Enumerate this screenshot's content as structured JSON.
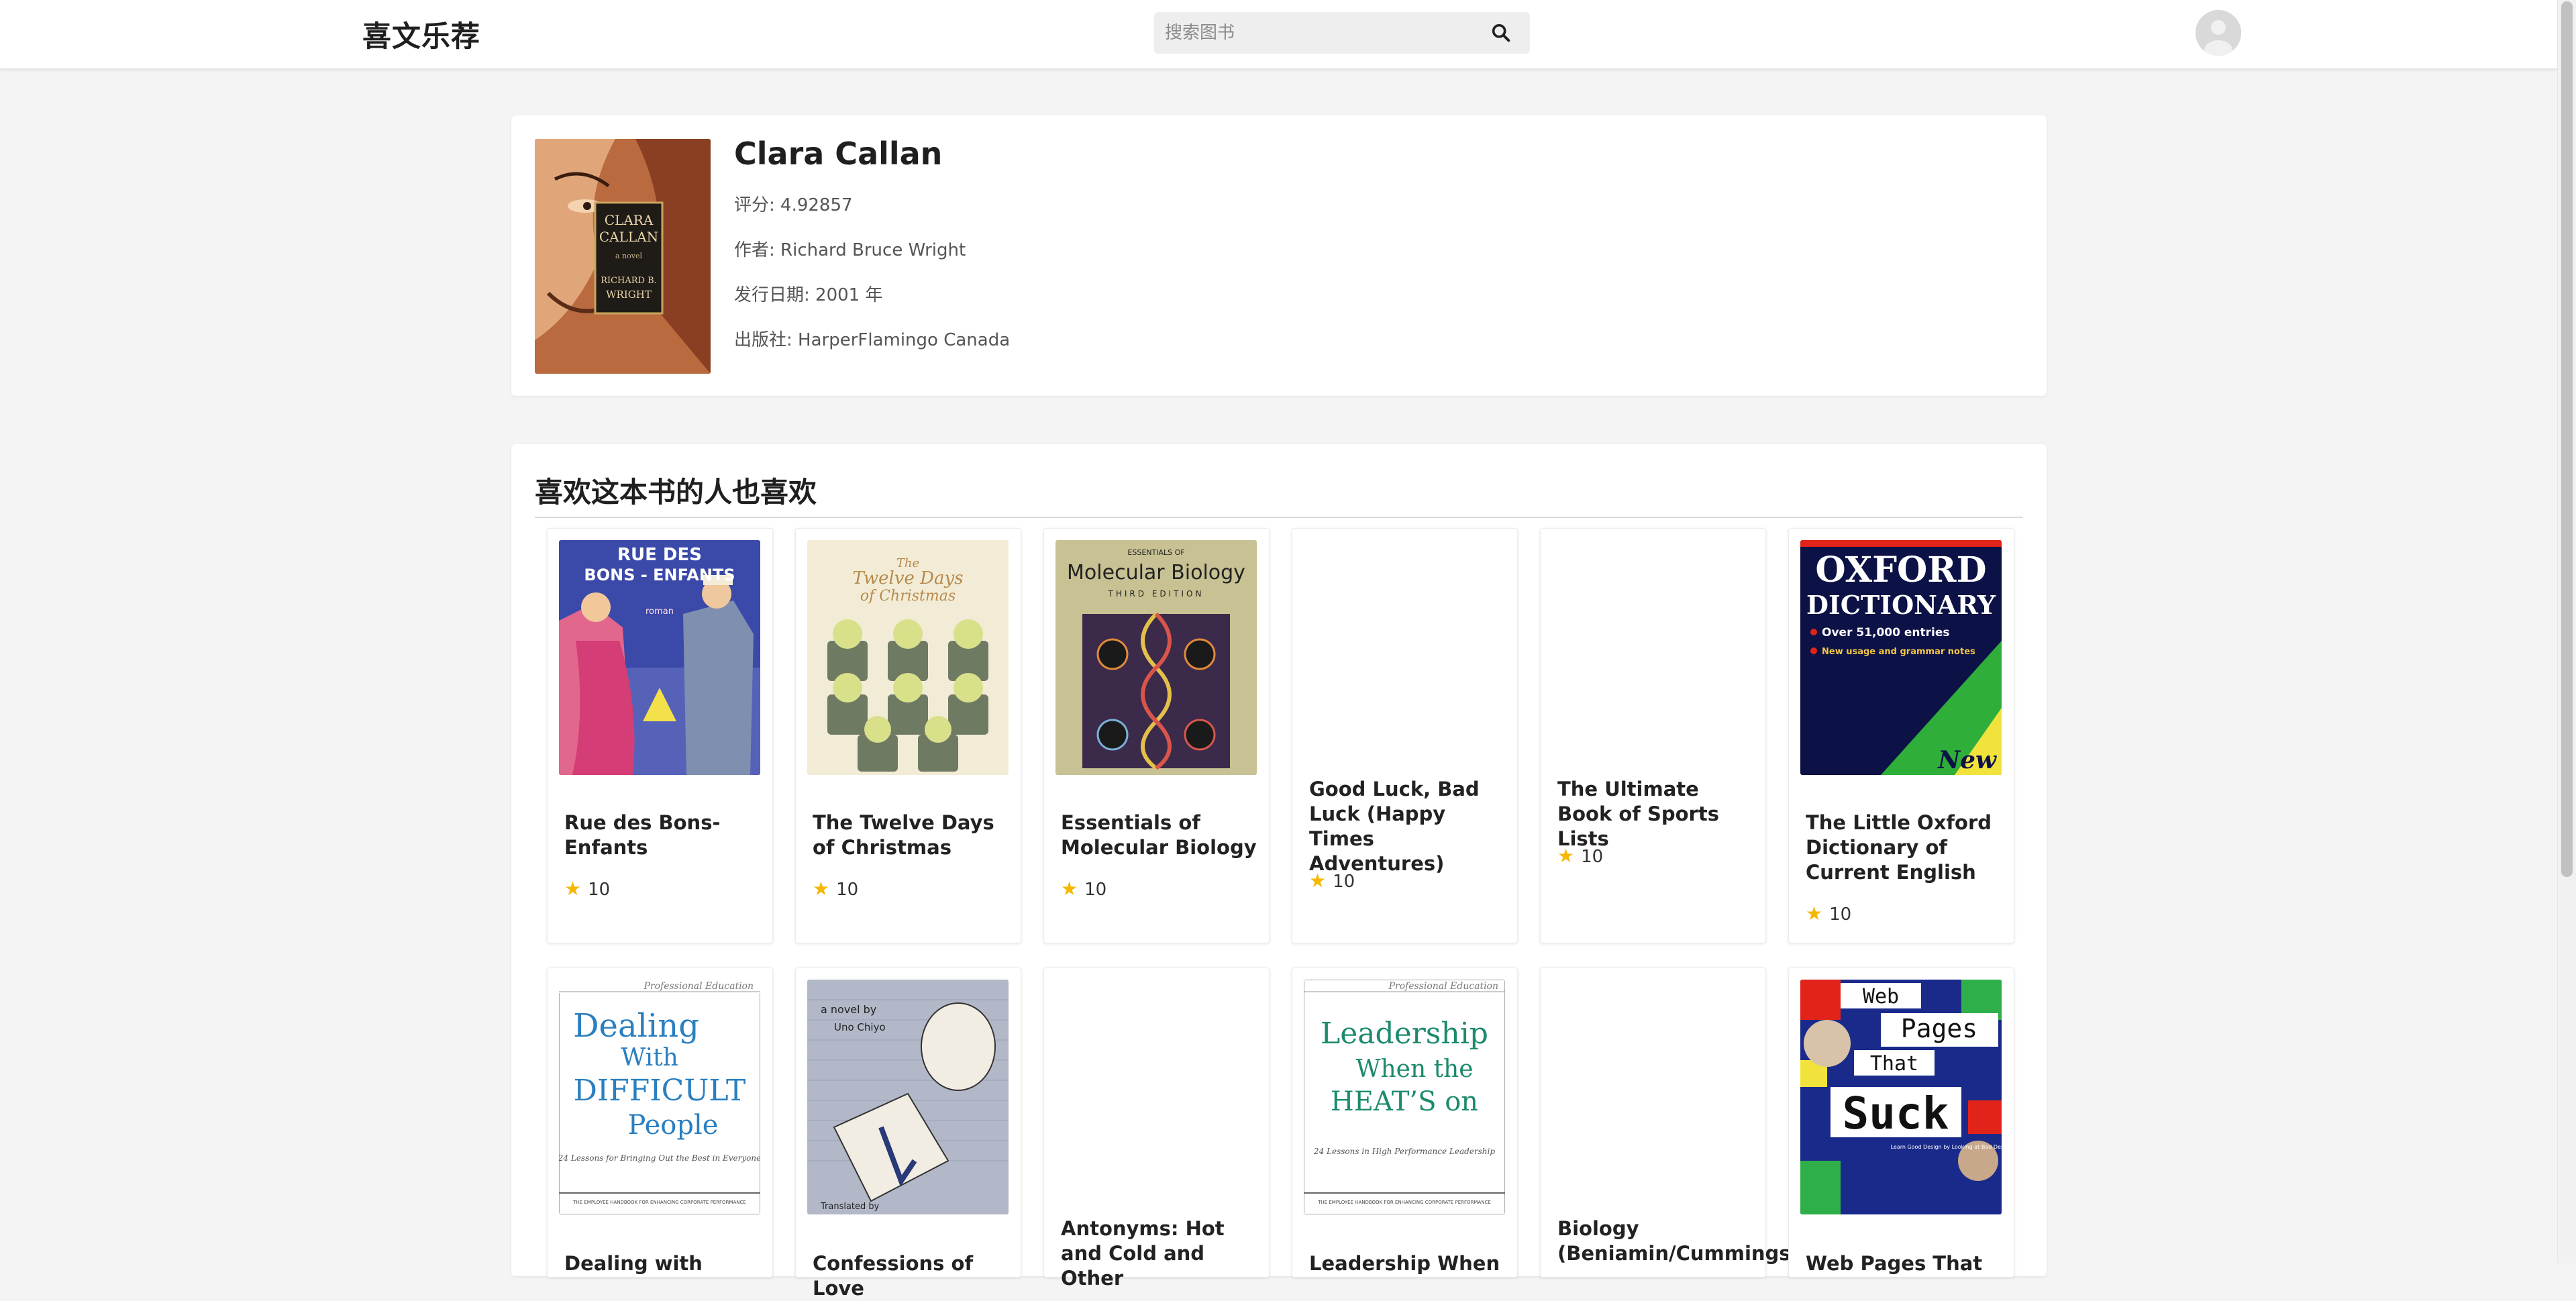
{
  "header": {
    "brand": "喜文乐荐",
    "search_placeholder": "搜索图书",
    "search_icon": "search-icon",
    "avatar_icon": "user-avatar-icon"
  },
  "book": {
    "title": "Clara Callan",
    "rating_label": "评分: 4.92857",
    "author_label": "作者: Richard Bruce Wright",
    "date_label": "发行日期: 2001 年",
    "publisher_label": "出版社: HarperFlamingo Canada",
    "cover": {
      "title_line1": "CLARA",
      "title_line2": "CALLAN",
      "subtitle": "a novel",
      "author_line1": "RICHARD B.",
      "author_line2": "WRIGHT"
    }
  },
  "recommendations": {
    "heading": "喜欢这本书的人也喜欢",
    "items": [
      {
        "title": "Rue des Bons-Enfants",
        "rating": "10",
        "cover_text_1": "RUE DES",
        "cover_text_2": "BONS - ENFANTS",
        "cover_text_3": "roman"
      },
      {
        "title": "The Twelve Days of Christmas",
        "rating": "10",
        "cover_text_1": "The",
        "cover_text_2": "Twelve Days",
        "cover_text_3": "of Christmas"
      },
      {
        "title": "Essentials of Molecular Biology",
        "rating": "10",
        "cover_text_1": "ESSENTIALS OF",
        "cover_text_2": "Molecular Biology",
        "cover_text_3": "THIRD EDITION"
      },
      {
        "title": "Good Luck, Bad Luck (Happy Times Adventures)",
        "rating": "10"
      },
      {
        "title": "The Ultimate Book of Sports Lists",
        "rating": "10"
      },
      {
        "title": "The Little Oxford Dictionary of Current English",
        "rating": "10",
        "cover_text_1": "OXFORD",
        "cover_text_2": "DICTIONARY",
        "cover_text_3": "Over 51,000 entries",
        "cover_text_4": "New usage and grammar notes",
        "cover_text_5": "New"
      },
      {
        "title": "Dealing with",
        "cover_text_1": "Professional Education",
        "cover_text_2": "Dealing",
        "cover_text_3": "With",
        "cover_text_4": "DIFFICULT",
        "cover_text_5": "People",
        "cover_text_6": "24 Lessons for Bringing Out the Best in Everyone",
        "cover_text_7": "THE EMPLOYEE HANDBOOK FOR ENHANCING CORPORATE PERFORMANCE"
      },
      {
        "title": "Confessions of Love",
        "cover_text_1": "a novel by",
        "cover_text_2": "Uno Chiyo",
        "cover_text_3": "Translated by"
      },
      {
        "title": "Antonyms: Hot and Cold and Other"
      },
      {
        "title": "Leadership When",
        "cover_text_1": "Professional Education",
        "cover_text_2": "Leadership",
        "cover_text_3": "When the",
        "cover_text_4": "HEAT’S on",
        "cover_text_5": "24 Lessons in High Performance Leadership",
        "cover_text_6": "THE EMPLOYEE HANDBOOK FOR ENHANCING CORPORATE PERFORMANCE"
      },
      {
        "title": "Biology (Beniamin/Cummings"
      },
      {
        "title": "Web Pages That",
        "cover_text_1": "Web",
        "cover_text_2": "Pages",
        "cover_text_3": "That",
        "cover_text_4": "Suck",
        "cover_text_5": "Learn Good Design by Looking at Bad Design"
      }
    ]
  },
  "colors": {
    "star": "#f5b700",
    "page_bg": "#f4f4f4",
    "card_bg": "#ffffff"
  }
}
